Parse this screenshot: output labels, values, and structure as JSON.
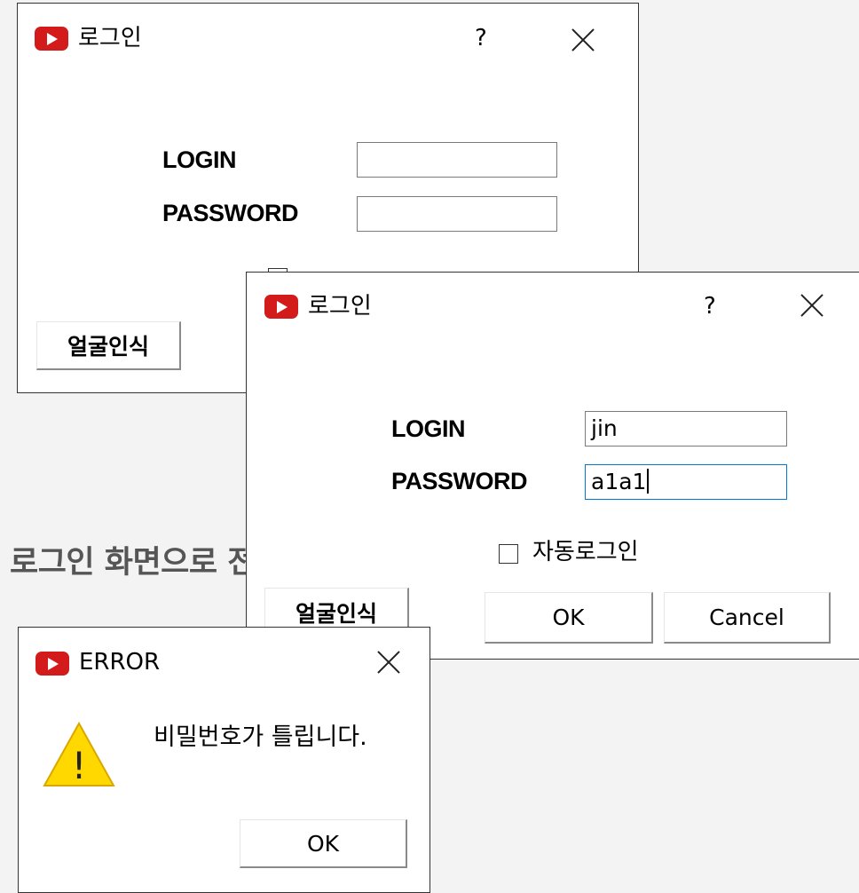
{
  "dialog_back": {
    "title": "로그인",
    "help": "?",
    "login_label": "LOGIN",
    "login_value": "",
    "password_label": "PASSWORD",
    "password_value": "",
    "face_button": "얼굴인식"
  },
  "dialog_front": {
    "title": "로그인",
    "help": "?",
    "login_label": "LOGIN",
    "login_value": "jin",
    "password_label": "PASSWORD",
    "password_value": "a1a1",
    "auto_login_label": "자동로그인",
    "auto_login_checked": false,
    "face_button": "얼굴인식",
    "ok_button": "OK",
    "cancel_button": "Cancel"
  },
  "caption": "로그인 화면으로 전",
  "error_dialog": {
    "title": "ERROR",
    "message": "비밀번호가 틀립니다.",
    "ok_button": "OK",
    "warning_glyph": "!"
  },
  "colors": {
    "app_icon": "#d31b1b",
    "focus_border": "#0078d7",
    "warning_fill": "#ffd800",
    "background": "#f3f3f3"
  },
  "icons": [
    "youtube-app-icon",
    "close-icon",
    "help-icon",
    "warning-icon",
    "checkbox"
  ]
}
